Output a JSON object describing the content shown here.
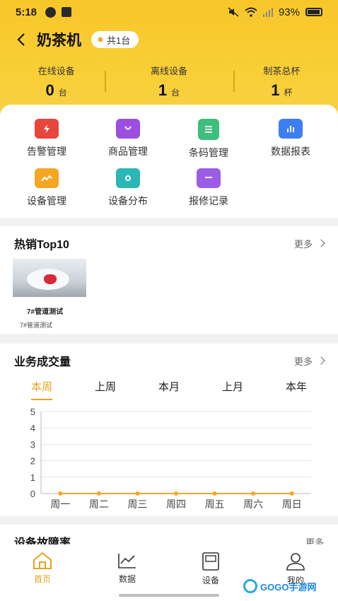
{
  "status_bar": {
    "time": "5:18",
    "battery": "93%"
  },
  "header": {
    "title": "奶茶机",
    "count_badge": "共1台",
    "stats": [
      {
        "label": "在线设备",
        "value": "0",
        "unit": "台"
      },
      {
        "label": "离线设备",
        "value": "1",
        "unit": "台"
      },
      {
        "label": "制茶总杯",
        "value": "1",
        "unit": "杯"
      }
    ]
  },
  "menu": [
    {
      "label": "告警管理",
      "icon": "alarm-icon",
      "color": "#e8453c"
    },
    {
      "label": "商品管理",
      "icon": "shopping-bag-icon",
      "color": "#9b4fe0"
    },
    {
      "label": "条码管理",
      "icon": "barcode-doc-icon",
      "color": "#3cbf7a"
    },
    {
      "label": "数据报表",
      "icon": "report-chart-icon",
      "color": "#3d7ff0"
    },
    {
      "label": "设备管理",
      "icon": "device-manage-icon",
      "color": "#f5a623"
    },
    {
      "label": "设备分布",
      "icon": "device-map-icon",
      "color": "#2bb7b3"
    },
    {
      "label": "报修记录",
      "icon": "repair-record-icon",
      "color": "#9b5de5"
    }
  ],
  "hot_sales": {
    "title": "热销Top10",
    "more": "更多",
    "product_name": "7#管道测试",
    "product_sub": "7#管道测试"
  },
  "volume": {
    "title": "业务成交量",
    "more": "更多",
    "tabs": [
      "本周",
      "上周",
      "本月",
      "上月",
      "本年"
    ],
    "active_tab": "本周"
  },
  "next_section_title": "设备故障率",
  "next_section_more": "更多",
  "chart_data": {
    "type": "line",
    "categories": [
      "周一",
      "周二",
      "周三",
      "周四",
      "周五",
      "周六",
      "周日"
    ],
    "series": [
      {
        "values": [
          0,
          0,
          0,
          0,
          0,
          0,
          0
        ]
      }
    ],
    "ylim": [
      0,
      5
    ],
    "yticks": [
      0,
      1,
      2,
      3,
      4,
      5
    ],
    "grid": true,
    "color": "#f5a623",
    "title": "",
    "xlabel": "",
    "ylabel": ""
  },
  "bottom_nav": [
    {
      "label": "首页",
      "icon": "home-icon",
      "active": true
    },
    {
      "label": "数据",
      "icon": "line-chart-icon",
      "active": false
    },
    {
      "label": "设备",
      "icon": "device-icon",
      "active": false
    },
    {
      "label": "我的",
      "icon": "user-icon",
      "active": false
    }
  ],
  "watermark": {
    "text": "GOGO手游网"
  }
}
